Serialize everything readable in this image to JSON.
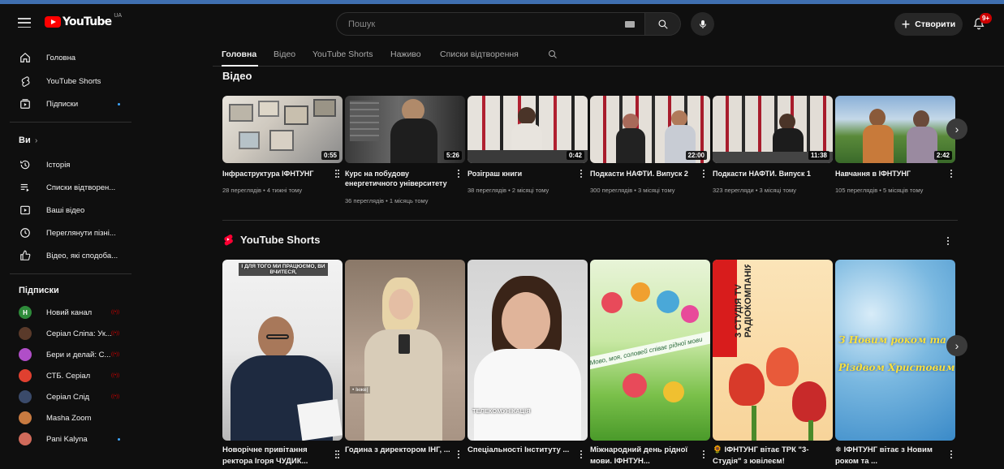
{
  "header": {
    "logo_text": "YouTube",
    "country": "UA",
    "search_placeholder": "Пошук",
    "create_label": "Створити",
    "notifications": "9+"
  },
  "sidebar": {
    "main": [
      {
        "label": "Головна",
        "icon": "home-icon"
      },
      {
        "label": "YouTube Shorts",
        "icon": "shorts-icon"
      },
      {
        "label": "Підписки",
        "icon": "subscriptions-icon"
      }
    ],
    "you_heading": "Ви",
    "you_items": [
      {
        "label": "Історія",
        "icon": "history-icon"
      },
      {
        "label": "Списки відтворен...",
        "icon": "playlists-icon"
      },
      {
        "label": "Ваші відео",
        "icon": "your-videos-icon"
      },
      {
        "label": "Переглянути пізні...",
        "icon": "watch-later-icon"
      },
      {
        "label": "Відео, які сподоба...",
        "icon": "liked-icon"
      }
    ],
    "subs_heading": "Підписки",
    "subscriptions": [
      {
        "label": "Новий канал",
        "avatar_color": "#2e8b3a",
        "avatar_letter": "Н",
        "live": true
      },
      {
        "label": "Серіал Сліпа: Ук...",
        "avatar_color": "#5a3a2a",
        "live": true
      },
      {
        "label": "Бери и делай: С...",
        "avatar_color": "#b04ec8",
        "live": true
      },
      {
        "label": "СТБ. Серіал",
        "avatar_color": "#e04030",
        "live": true
      },
      {
        "label": "Серіал Слід",
        "avatar_color": "#3a4a6a",
        "live": true
      },
      {
        "label": "Masha Zoom",
        "avatar_color": "#c87a40",
        "live": false
      },
      {
        "label": "Pani Kalyna",
        "avatar_color": "#d06a5a",
        "live": false
      }
    ]
  },
  "tabs": [
    {
      "label": "Головна",
      "active": true
    },
    {
      "label": "Відео",
      "active": false
    },
    {
      "label": "YouTube Shorts",
      "active": false
    },
    {
      "label": "Наживо",
      "active": false
    },
    {
      "label": "Списки відтворення",
      "active": false
    }
  ],
  "videos_section": {
    "title": "Відео",
    "items": [
      {
        "title": "Інфраструктура ІФНТУНГ",
        "meta": "28 переглядів • 4 тижні тому",
        "duration": "0:55"
      },
      {
        "title": "Курс на побудову енергетичного університету",
        "meta": "36 переглядів • 1 місяць тому",
        "duration": "5:26"
      },
      {
        "title": "Розіграш книги",
        "meta": "38 переглядів • 2 місяці тому",
        "duration": "0:42"
      },
      {
        "title": "Подкасти НАФТИ. Випуск 2",
        "meta": "300 переглядів • 3 місяці тому",
        "duration": "22:00"
      },
      {
        "title": "Подкасти НАФТИ. Випуск 1",
        "meta": "323 перегляди • 3 місяці тому",
        "duration": "11:38"
      },
      {
        "title": "Навчання в ІФНТУНГ",
        "meta": "105 переглядів • 5 місяців тому",
        "duration": "2:42"
      }
    ]
  },
  "shorts_section": {
    "title": "YouTube Shorts",
    "items": [
      {
        "title": "Новорічне привітання ректора Ігоря ЧУДИК...",
        "overlay": "І ДЛЯ ТОГО МИ ПРАЦЮЄМО, ВИ ВЧИТЕСЯ,"
      },
      {
        "title": "Година з директором ІНГ, ...",
        "overlay": "• Інже|"
      },
      {
        "title": "Спеціальності Інституту ...",
        "overlay": "ТЕЛЕКОМУНІКАЦІЯ"
      },
      {
        "title": "Міжнародний день рідної мови. ІФНТУН...",
        "overlay": "Мово, моя, соловей співає рідної мови"
      },
      {
        "title": "🌻 ІФНТУНГ вітає ТРК \"3-Студія\" з ювілеєм!",
        "overlay": "3 СТУДІЯ TV РАДІОКОМПАНІЯ"
      },
      {
        "title": "❄ ІФНТУНГ вітає з Новим роком та ...",
        "overlay": "З Новим роком та Різдвом Христовим"
      }
    ]
  },
  "colors": {
    "background": "#0f0f0f",
    "accent": "#ff0000",
    "text": "#f1f1f1",
    "muted": "#aaaaaa"
  }
}
